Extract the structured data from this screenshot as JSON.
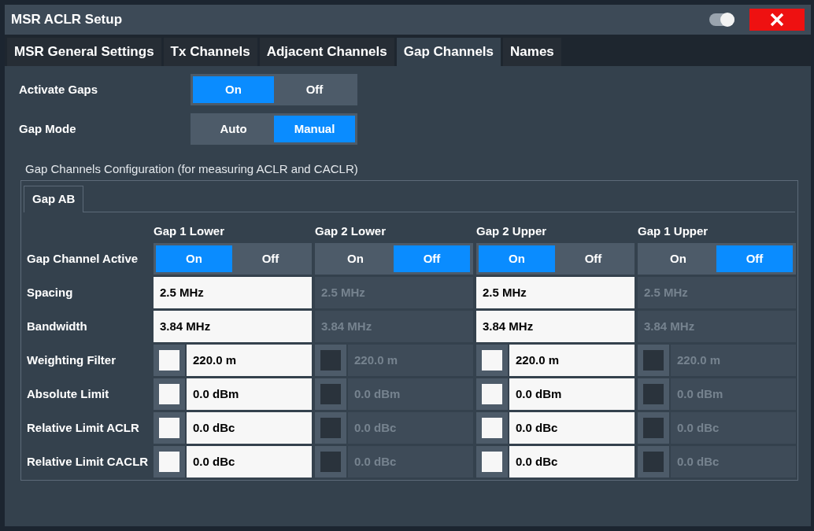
{
  "window": {
    "title": "MSR ACLR Setup"
  },
  "tabs": [
    {
      "label": "MSR General Settings",
      "selected": false
    },
    {
      "label": "Tx Channels",
      "selected": false
    },
    {
      "label": "Adjacent Channels",
      "selected": false
    },
    {
      "label": "Gap Channels",
      "selected": true
    },
    {
      "label": "Names",
      "selected": false
    }
  ],
  "settings": [
    {
      "label": "Activate Gaps",
      "options": [
        {
          "label": "On",
          "selected": true
        },
        {
          "label": "Off",
          "selected": false
        }
      ]
    },
    {
      "label": "Gap Mode",
      "options": [
        {
          "label": "Auto",
          "selected": false
        },
        {
          "label": "Manual",
          "selected": true
        }
      ]
    }
  ],
  "config": {
    "title": "Gap Channels Configuration (for measuring ACLR and CACLR)",
    "tabs": [
      {
        "label": "Gap AB",
        "selected": true
      }
    ],
    "row_labels": [
      "Gap Channel Active",
      "Spacing",
      "Bandwidth",
      "Weighting Filter",
      "Absolute Limit",
      "Relative Limit ACLR",
      "Relative Limit CACLR"
    ],
    "columns": [
      {
        "name": "Gap 1 Lower",
        "active": [
          {
            "label": "On",
            "selected": true
          },
          {
            "label": "Off",
            "selected": false
          }
        ],
        "spacing": "2.5 MHz",
        "bandwidth": "3.84 MHz",
        "limits": [
          {
            "checked": false,
            "value": "220.0 m"
          },
          {
            "checked": false,
            "value": "0.0 dBm"
          },
          {
            "checked": false,
            "value": "0.0 dBc"
          },
          {
            "checked": false,
            "value": "0.0 dBc"
          }
        ]
      },
      {
        "name": "Gap 2 Lower",
        "active": [
          {
            "label": "On",
            "selected": false
          },
          {
            "label": "Off",
            "selected": true
          }
        ],
        "spacing": "2.5 MHz",
        "bandwidth": "3.84 MHz",
        "limits": [
          {
            "checked": false,
            "value": "220.0 m"
          },
          {
            "checked": false,
            "value": "0.0 dBm"
          },
          {
            "checked": false,
            "value": "0.0 dBc"
          },
          {
            "checked": false,
            "value": "0.0 dBc"
          }
        ]
      },
      {
        "name": "Gap 2 Upper",
        "active": [
          {
            "label": "On",
            "selected": true
          },
          {
            "label": "Off",
            "selected": false
          }
        ],
        "spacing": "2.5 MHz",
        "bandwidth": "3.84 MHz",
        "limits": [
          {
            "checked": false,
            "value": "220.0 m"
          },
          {
            "checked": false,
            "value": "0.0 dBm"
          },
          {
            "checked": false,
            "value": "0.0 dBc"
          },
          {
            "checked": false,
            "value": "0.0 dBc"
          }
        ]
      },
      {
        "name": "Gap 1 Upper",
        "active": [
          {
            "label": "On",
            "selected": false
          },
          {
            "label": "Off",
            "selected": true
          }
        ],
        "spacing": "2.5 MHz",
        "bandwidth": "3.84 MHz",
        "limits": [
          {
            "checked": false,
            "value": "220.0 m"
          },
          {
            "checked": false,
            "value": "0.0 dBm"
          },
          {
            "checked": false,
            "value": "0.0 dBc"
          },
          {
            "checked": false,
            "value": "0.0 dBc"
          }
        ]
      }
    ]
  }
}
